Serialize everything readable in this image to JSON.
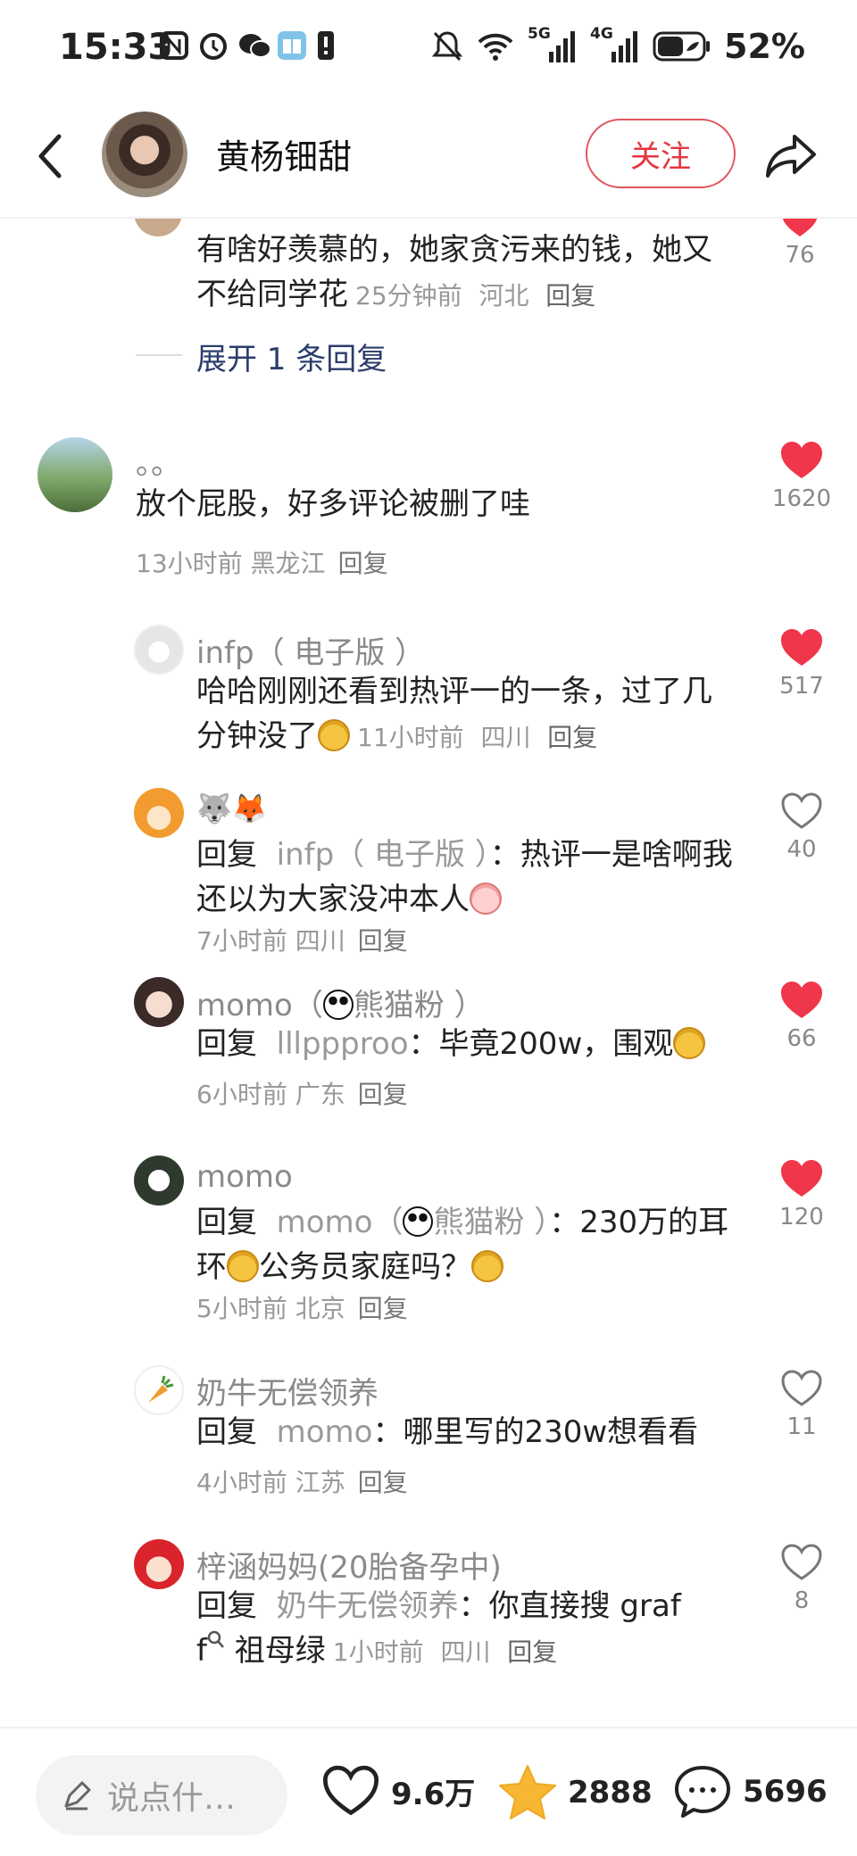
{
  "status_bar": {
    "time": "15:33",
    "network_labels": [
      "5G",
      "4G"
    ],
    "battery_percent": "52%"
  },
  "header": {
    "title": "黄杨钿甜",
    "follow_label": "关注"
  },
  "comments": {
    "top_partial": {
      "text": "有啥好羡慕的，她家贪污来的钱，她又不给同学花",
      "time": "25分钟前",
      "location": "河北",
      "reply": "回复",
      "likes": "76",
      "expand": "展开 1 条回复"
    },
    "main": {
      "username": "。。",
      "text": "放个屁股，好多评论被删了哇",
      "time": "13小时前",
      "location": "黑龙江",
      "reply": "回复",
      "likes": "1620"
    },
    "replies": [
      {
        "username": "infp（ 电子版 ）",
        "text": "哈哈刚刚还看到热评一的一条，过了几分钟没了",
        "time": "11小时前",
        "location": "四川",
        "reply": "回复",
        "likes": "517",
        "liked": true
      },
      {
        "username": "🐺🦊",
        "prefix": "回复",
        "target": "infp（ 电子版 ）",
        "text": "：热评一是啥啊我还以为大家没冲本人",
        "time": "7小时前",
        "location": "四川",
        "reply": "回复",
        "likes": "40",
        "liked": false
      },
      {
        "username": "momo（",
        "username_suffix": "熊猫粉 ）",
        "prefix": "回复",
        "target": "lllppproo",
        "text": "：毕竟200w，围观",
        "time": "6小时前",
        "location": "广东",
        "reply": "回复",
        "likes": "66",
        "liked": true
      },
      {
        "username": "momo",
        "prefix": "回复",
        "target": "momo（",
        "target_suffix": "熊猫粉 ）",
        "text": "：230万的耳环",
        "text2": "公务员家庭吗？",
        "time": "5小时前",
        "location": "北京",
        "reply": "回复",
        "likes": "120",
        "liked": true
      },
      {
        "username": "奶牛无偿领养",
        "prefix": "回复",
        "target": "momo",
        "text": "：哪里写的230w想看看",
        "time": "4小时前",
        "location": "江苏",
        "reply": "回复",
        "likes": "11",
        "liked": false
      },
      {
        "username": "梓涵妈妈(20胎备孕中)",
        "prefix": "回复",
        "target": "奶牛无偿领养",
        "text": "：你直接搜 graf",
        "text2": "f",
        "text3": "祖母绿",
        "time": "1小时前",
        "location": "四川",
        "reply": "回复",
        "likes": "8",
        "liked": false
      }
    ]
  },
  "bottom_bar": {
    "input_placeholder": "说点什…",
    "likes": "9.6万",
    "favorites": "2888",
    "comments": "5696"
  },
  "colors": {
    "heart_red": "#f0364a",
    "follow_red": "#e5363f",
    "star_yellow": "#f7b733",
    "link_blue": "#2b3d6b"
  }
}
